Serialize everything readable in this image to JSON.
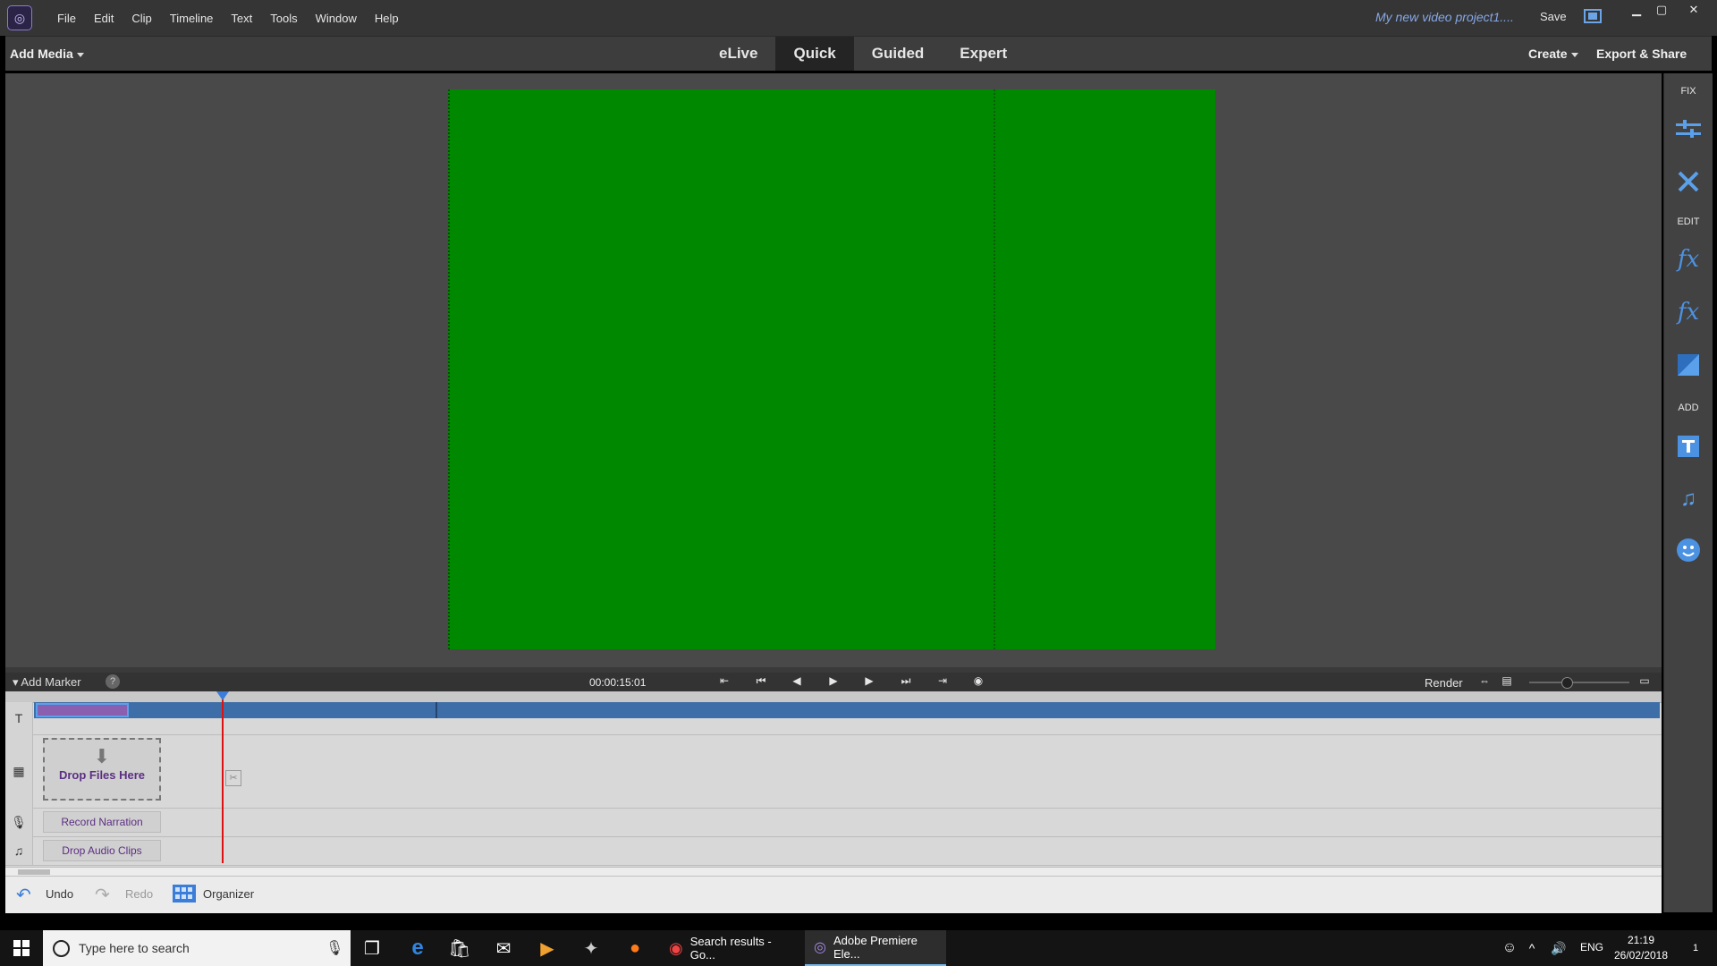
{
  "window": {
    "menu": [
      "File",
      "Edit",
      "Clip",
      "Timeline",
      "Text",
      "Tools",
      "Window",
      "Help"
    ],
    "project_title": "My new video project1....",
    "save_label": "Save"
  },
  "modebar": {
    "add_media": "Add Media",
    "tabs": [
      "eLive",
      "Quick",
      "Guided",
      "Expert"
    ],
    "active_tab": "Quick",
    "create": "Create",
    "export": "Export & Share"
  },
  "right_panel": {
    "fix_label": "FIX",
    "edit_label": "EDIT",
    "add_label": "ADD",
    "fx_glyph": "fx"
  },
  "timeline": {
    "add_marker": "Add Marker",
    "help": "?",
    "timecode": "00:00:15:01",
    "render": "Render",
    "drop_files": "Drop Files Here",
    "record_narration": "Record Narration",
    "drop_audio": "Drop Audio Clips",
    "title_track_glyph": "T"
  },
  "bottombar": {
    "undo": "Undo",
    "redo": "Redo",
    "organizer": "Organizer"
  },
  "taskbar": {
    "search_placeholder": "Type here to search",
    "tasks": [
      "Search results - Go...",
      "Adobe Premiere Ele..."
    ],
    "lang": "ENG",
    "time": "21:19",
    "date": "26/02/2018",
    "notification_count": "1"
  },
  "colors": {
    "preview": "#008800",
    "accent": "#3b7dd8",
    "clip_purple": "#8b5fb0"
  }
}
